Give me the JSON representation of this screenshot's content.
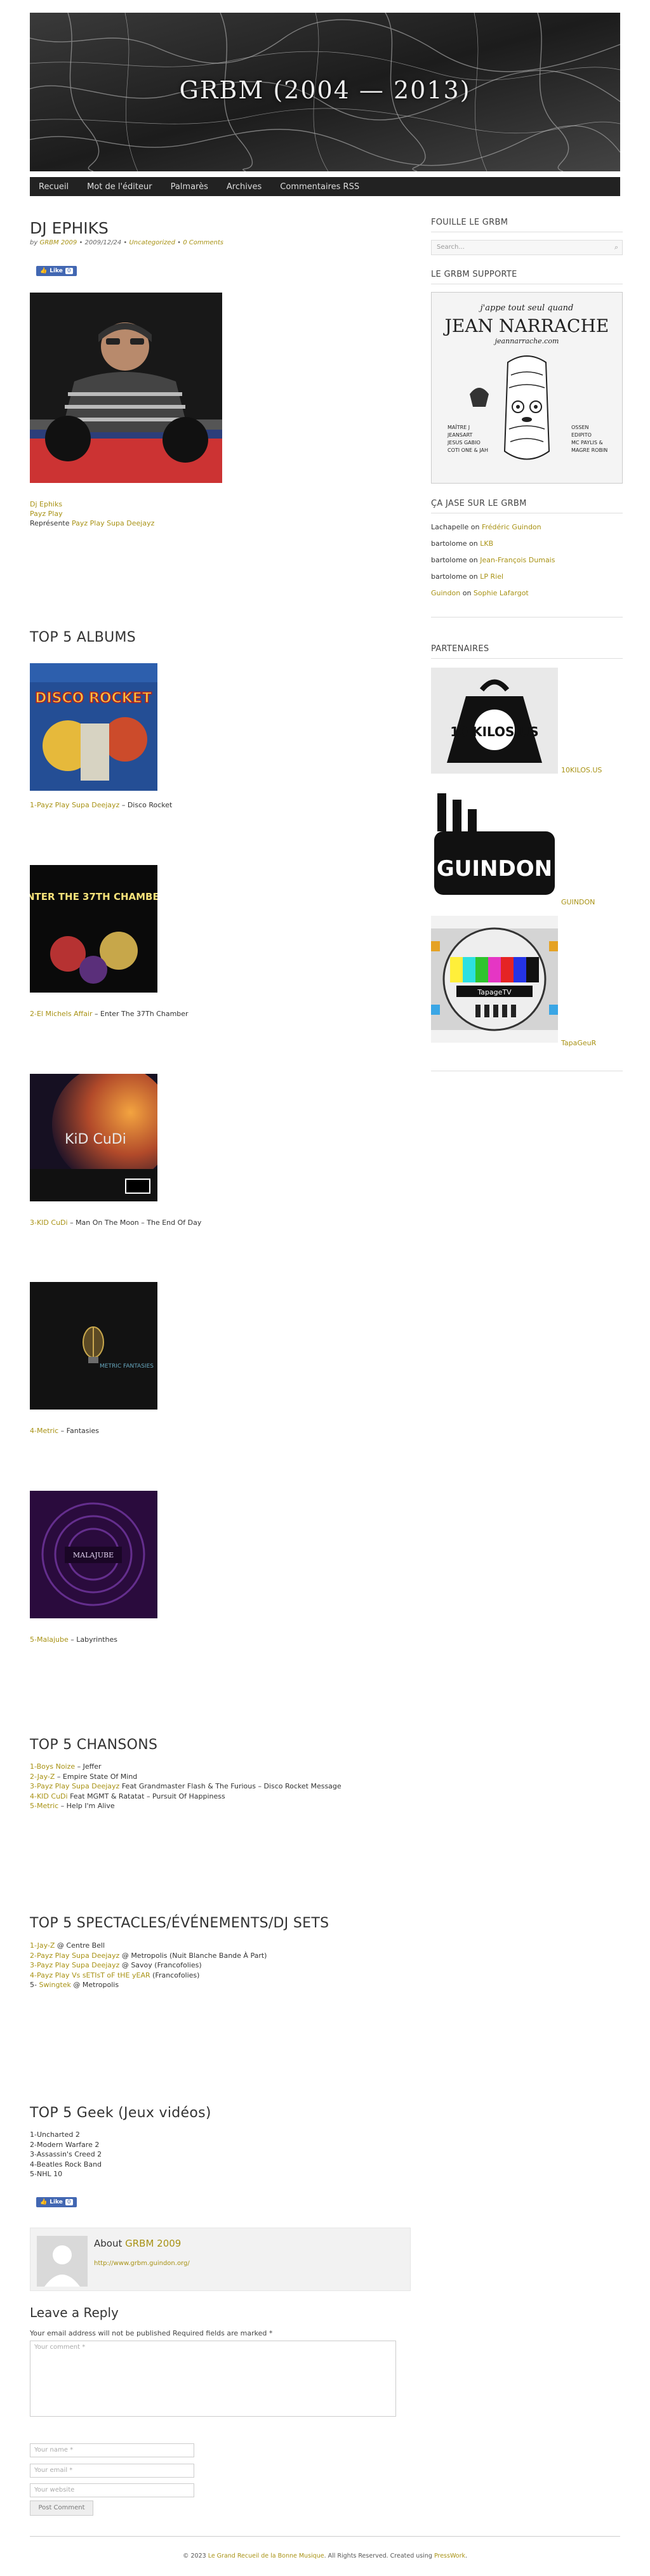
{
  "site": {
    "title": "GRBM (2004 — 2013)"
  },
  "nav": [
    "Recueil",
    "Mot de l'éditeur",
    "Palmarès",
    "Archives",
    "Commentaires RSS"
  ],
  "post": {
    "title": "DJ EPHIKS",
    "byline": {
      "by": "by",
      "author": "GRBM 2009",
      "date": "• 2009/12/24 •",
      "category": "Uncategorized",
      "sep": "•",
      "comments": "0 Comments"
    },
    "fb_like": "Like",
    "fb_count": "0",
    "intro": {
      "line1": "Dj Ephiks",
      "line2": "Payz Play",
      "line3_prefix": "Représente ",
      "line3_link": "Payz Play Supa Deejayz"
    },
    "top5_albums": {
      "title": "TOP 5 ALBUMS",
      "items": [
        {
          "num": "1-",
          "artist": "Payz Play Supa Deejayz",
          "album": " – Disco Rocket"
        },
        {
          "num": "2-",
          "artist": "El Michels Affair",
          "album": " – Enter The 37Th Chamber"
        },
        {
          "num": "3-",
          "artist": "KID CuDi",
          "album": " – Man On The Moon – The End Of Day"
        },
        {
          "num": "4-",
          "artist": "Metric",
          "album": " – Fantasies"
        },
        {
          "num": "5-",
          "artist": "Malajube",
          "album": " – Labyrinthes"
        }
      ],
      "covers": [
        "DISCO ROCKET",
        "ENTER THE 37TH CHAMBER",
        "KiD CuDi",
        "METRIC FANTASIES",
        "MALAJUBE"
      ]
    },
    "top5_chansons": {
      "title": "TOP 5 CHANSONS",
      "items": [
        {
          "num": "1-",
          "artist": "Boys Noize",
          "rest": " – Jeffer"
        },
        {
          "num": "2-",
          "artist": "Jay-Z",
          "rest": " – Empire State Of Mind"
        },
        {
          "num": "3-",
          "artist": "Payz Play Supa Deejayz",
          "rest": " Feat Grandmaster Flash & The Furious – Disco Rocket Message"
        },
        {
          "num": "4-",
          "artist": "KID CuDi",
          "rest": " Feat MGMT & Ratatat – Pursuit Of Happiness"
        },
        {
          "num": "5-",
          "artist": "Metric",
          "rest": " – Help I'm Alive"
        }
      ]
    },
    "top5_spectacles": {
      "title": "TOP 5 SPECTACLES/ÉVÉNEMENTS/DJ SETS",
      "items": [
        {
          "num": "1-",
          "artist": "Jay-Z",
          "rest": " @ Centre Bell"
        },
        {
          "num": "2-",
          "artist": "Payz Play Supa Deejayz",
          "rest": " @ Metropolis (Nuit Blanche Bande À Part)"
        },
        {
          "num": "3-",
          "artist": "Payz Play Supa Deejayz",
          "rest": " @ Savoy (Francofolies)"
        },
        {
          "num": "4-",
          "artist": "Payz Play Vs sETIsT oF tHE yEAR",
          "rest": " (Francofolies)"
        },
        {
          "num": "5- ",
          "artist": "Swingtek",
          "rest": " @ Metropolis"
        }
      ]
    },
    "top5_geek": {
      "title": "TOP 5 Geek (Jeux vidéos)",
      "items": [
        "1-Uncharted 2",
        "2-Modern Warfare 2",
        "3-Assassin's Creed 2",
        "4-Beatles Rock Band",
        "5-NHL 10"
      ]
    },
    "about": {
      "prefix": "About ",
      "name": "GRBM 2009",
      "url": "http://www.grbm.guindon.org/"
    }
  },
  "reply": {
    "title": "Leave a Reply",
    "notes": "Your email address will not be published Required fields are marked *",
    "comment_placeholder": "Your comment *",
    "name_placeholder": "Your name *",
    "email_placeholder": "Your email *",
    "website_placeholder": "Your website",
    "submit": "Post Comment"
  },
  "sidebar": {
    "search_title": "FOUILLE LE GRBM",
    "search_placeholder": "Search...",
    "supporte_title": "LE GRBM SUPPORTE",
    "ad": {
      "top": "j'appe tout seul quand",
      "name": "JEAN NARRACHE",
      "site": "jeannarrache.com",
      "left": [
        "MAÎTRE J",
        "JEANSART",
        "JESUS GABIO",
        "COTI ONE & JAH"
      ],
      "right": [
        "OSSEN",
        "EDIPITO",
        "MC PAYLIS &",
        "MAGRE ROBIN"
      ]
    },
    "jase_title": "ÇA JASE SUR LE GRBM",
    "comments": [
      {
        "who": "Lachapelle",
        "on": " on ",
        "post": "Frédéric Guindon",
        "who_link": false
      },
      {
        "who": "bartolome",
        "on": " on ",
        "post": "LKB",
        "who_link": false
      },
      {
        "who": "bartolome",
        "on": " on ",
        "post": "Jean-François Dumais",
        "who_link": false
      },
      {
        "who": "bartolome",
        "on": " on ",
        "post": "LP Riel",
        "who_link": false
      },
      {
        "who": "Guindon",
        "on": " on ",
        "post": "Sophie Lafargot",
        "who_link": true
      }
    ],
    "partners_title": "PARTENAIRES",
    "partners": [
      {
        "logo": "10 KILOS.US",
        "label": "10KILOS.US"
      },
      {
        "logo": "GUINDON",
        "label": "GUINDON"
      },
      {
        "logo": "TapageTV",
        "label": "TapaGeuR"
      }
    ]
  },
  "footer": {
    "prefix": "© 2023 ",
    "link1": "Le Grand Recueil de la Bonne Musique",
    "mid": ". All Rights Reserved. Created using ",
    "link2": "PressWork",
    "suffix": "."
  }
}
